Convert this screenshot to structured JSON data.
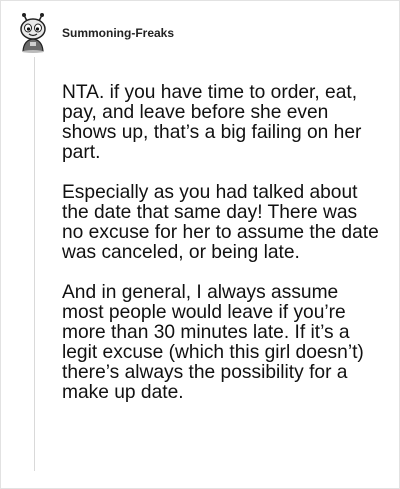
{
  "post": {
    "username": "Summoning-Freaks",
    "paragraphs": [
      "NTA. if you have time to order, eat, pay, and leave before she even shows up, that’s a big failing on her part.",
      "Especially as you had talked about the date that same day! There was no excuse for her to assume the date was canceled, or being late.",
      "And in general, I always assume most people would leave if you’re more than 30 minutes late. If it’s a legit excuse (which this girl doesn’t) there’s always the possibility for a make up date."
    ]
  },
  "colors": {
    "text": "#111111",
    "thread_line": "#d9d9d9",
    "border": "#e2e2e2"
  },
  "icons": {
    "avatar": "cartoon-creature-avatar-icon"
  }
}
